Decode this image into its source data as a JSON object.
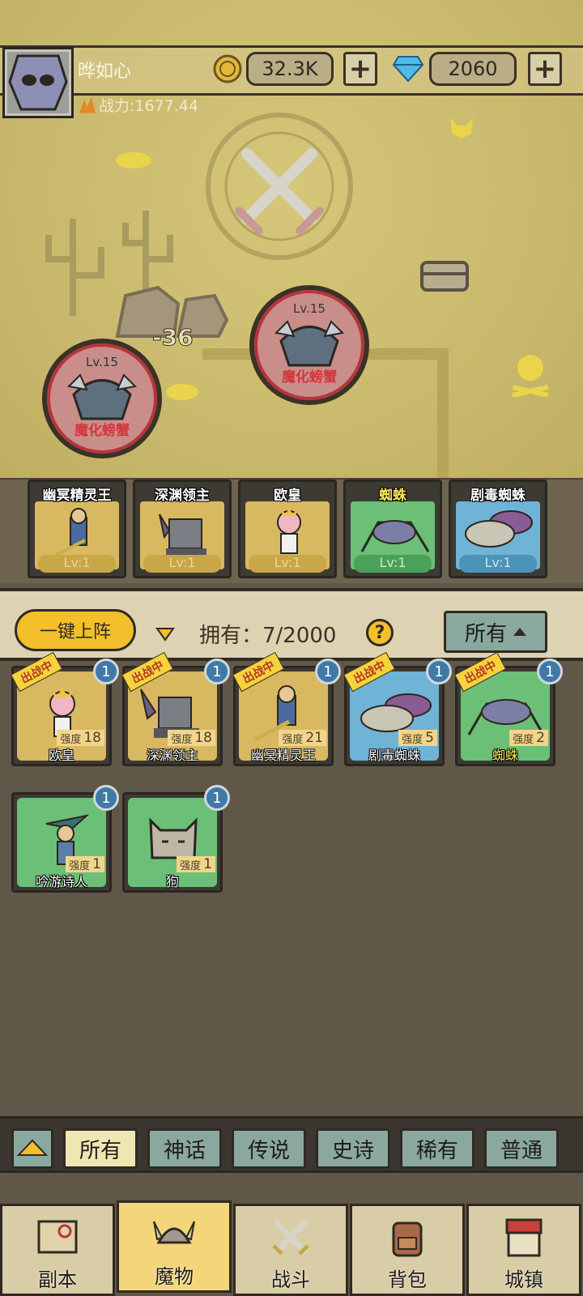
{
  "player": {
    "name": "晔如心",
    "power": "战力:1677.44"
  },
  "resources": {
    "gold": "32.3K",
    "diamonds": "2060",
    "plus": "+"
  },
  "map": {
    "damage_text": "-36",
    "enemies": [
      {
        "level": "Lv.15",
        "name": "魔化螃蟹"
      },
      {
        "level": "Lv.15",
        "name": "魔化螃蟹"
      }
    ]
  },
  "lineup": [
    {
      "name": "幽冥精灵王",
      "level": "Lv:1"
    },
    {
      "name": "深渊领主",
      "level": "Lv:1"
    },
    {
      "name": "欧皇",
      "level": "Lv:1"
    },
    {
      "name": "蜘蛛",
      "level": "Lv:1"
    },
    {
      "name": "剧毒蜘蛛",
      "level": "Lv:1"
    }
  ],
  "toolbar": {
    "deploy_label": "一键上阵",
    "owned_label": "拥有：7/2000",
    "help": "?",
    "filter_label": "所有"
  },
  "monsters": {
    "in_battle_label": "出战中",
    "strength_label": "强度",
    "items": [
      {
        "name": "欧皇",
        "strength": "18",
        "count": "1",
        "in_battle": true
      },
      {
        "name": "深渊领主",
        "strength": "18",
        "count": "1",
        "in_battle": true
      },
      {
        "name": "幽冥精灵王",
        "strength": "21",
        "count": "1",
        "in_battle": true
      },
      {
        "name": "剧毒蜘蛛",
        "strength": "5",
        "count": "1",
        "in_battle": true
      },
      {
        "name": "蜘蛛",
        "strength": "2",
        "count": "1",
        "in_battle": true
      },
      {
        "name": "吟游诗人",
        "strength": "1",
        "count": "1",
        "in_battle": false
      },
      {
        "name": "狗",
        "strength": "1",
        "count": "1",
        "in_battle": false
      }
    ]
  },
  "rarity_tabs": [
    "所有",
    "神话",
    "传说",
    "史诗",
    "稀有",
    "普通"
  ],
  "nav": [
    "副本",
    "魔物",
    "战斗",
    "背包",
    "城镇"
  ],
  "colors": {
    "accent": "#f3bf2a",
    "tab": "#8aa89e",
    "tab_active": "#efe6b3",
    "enemy_ring": "#b8353b"
  }
}
